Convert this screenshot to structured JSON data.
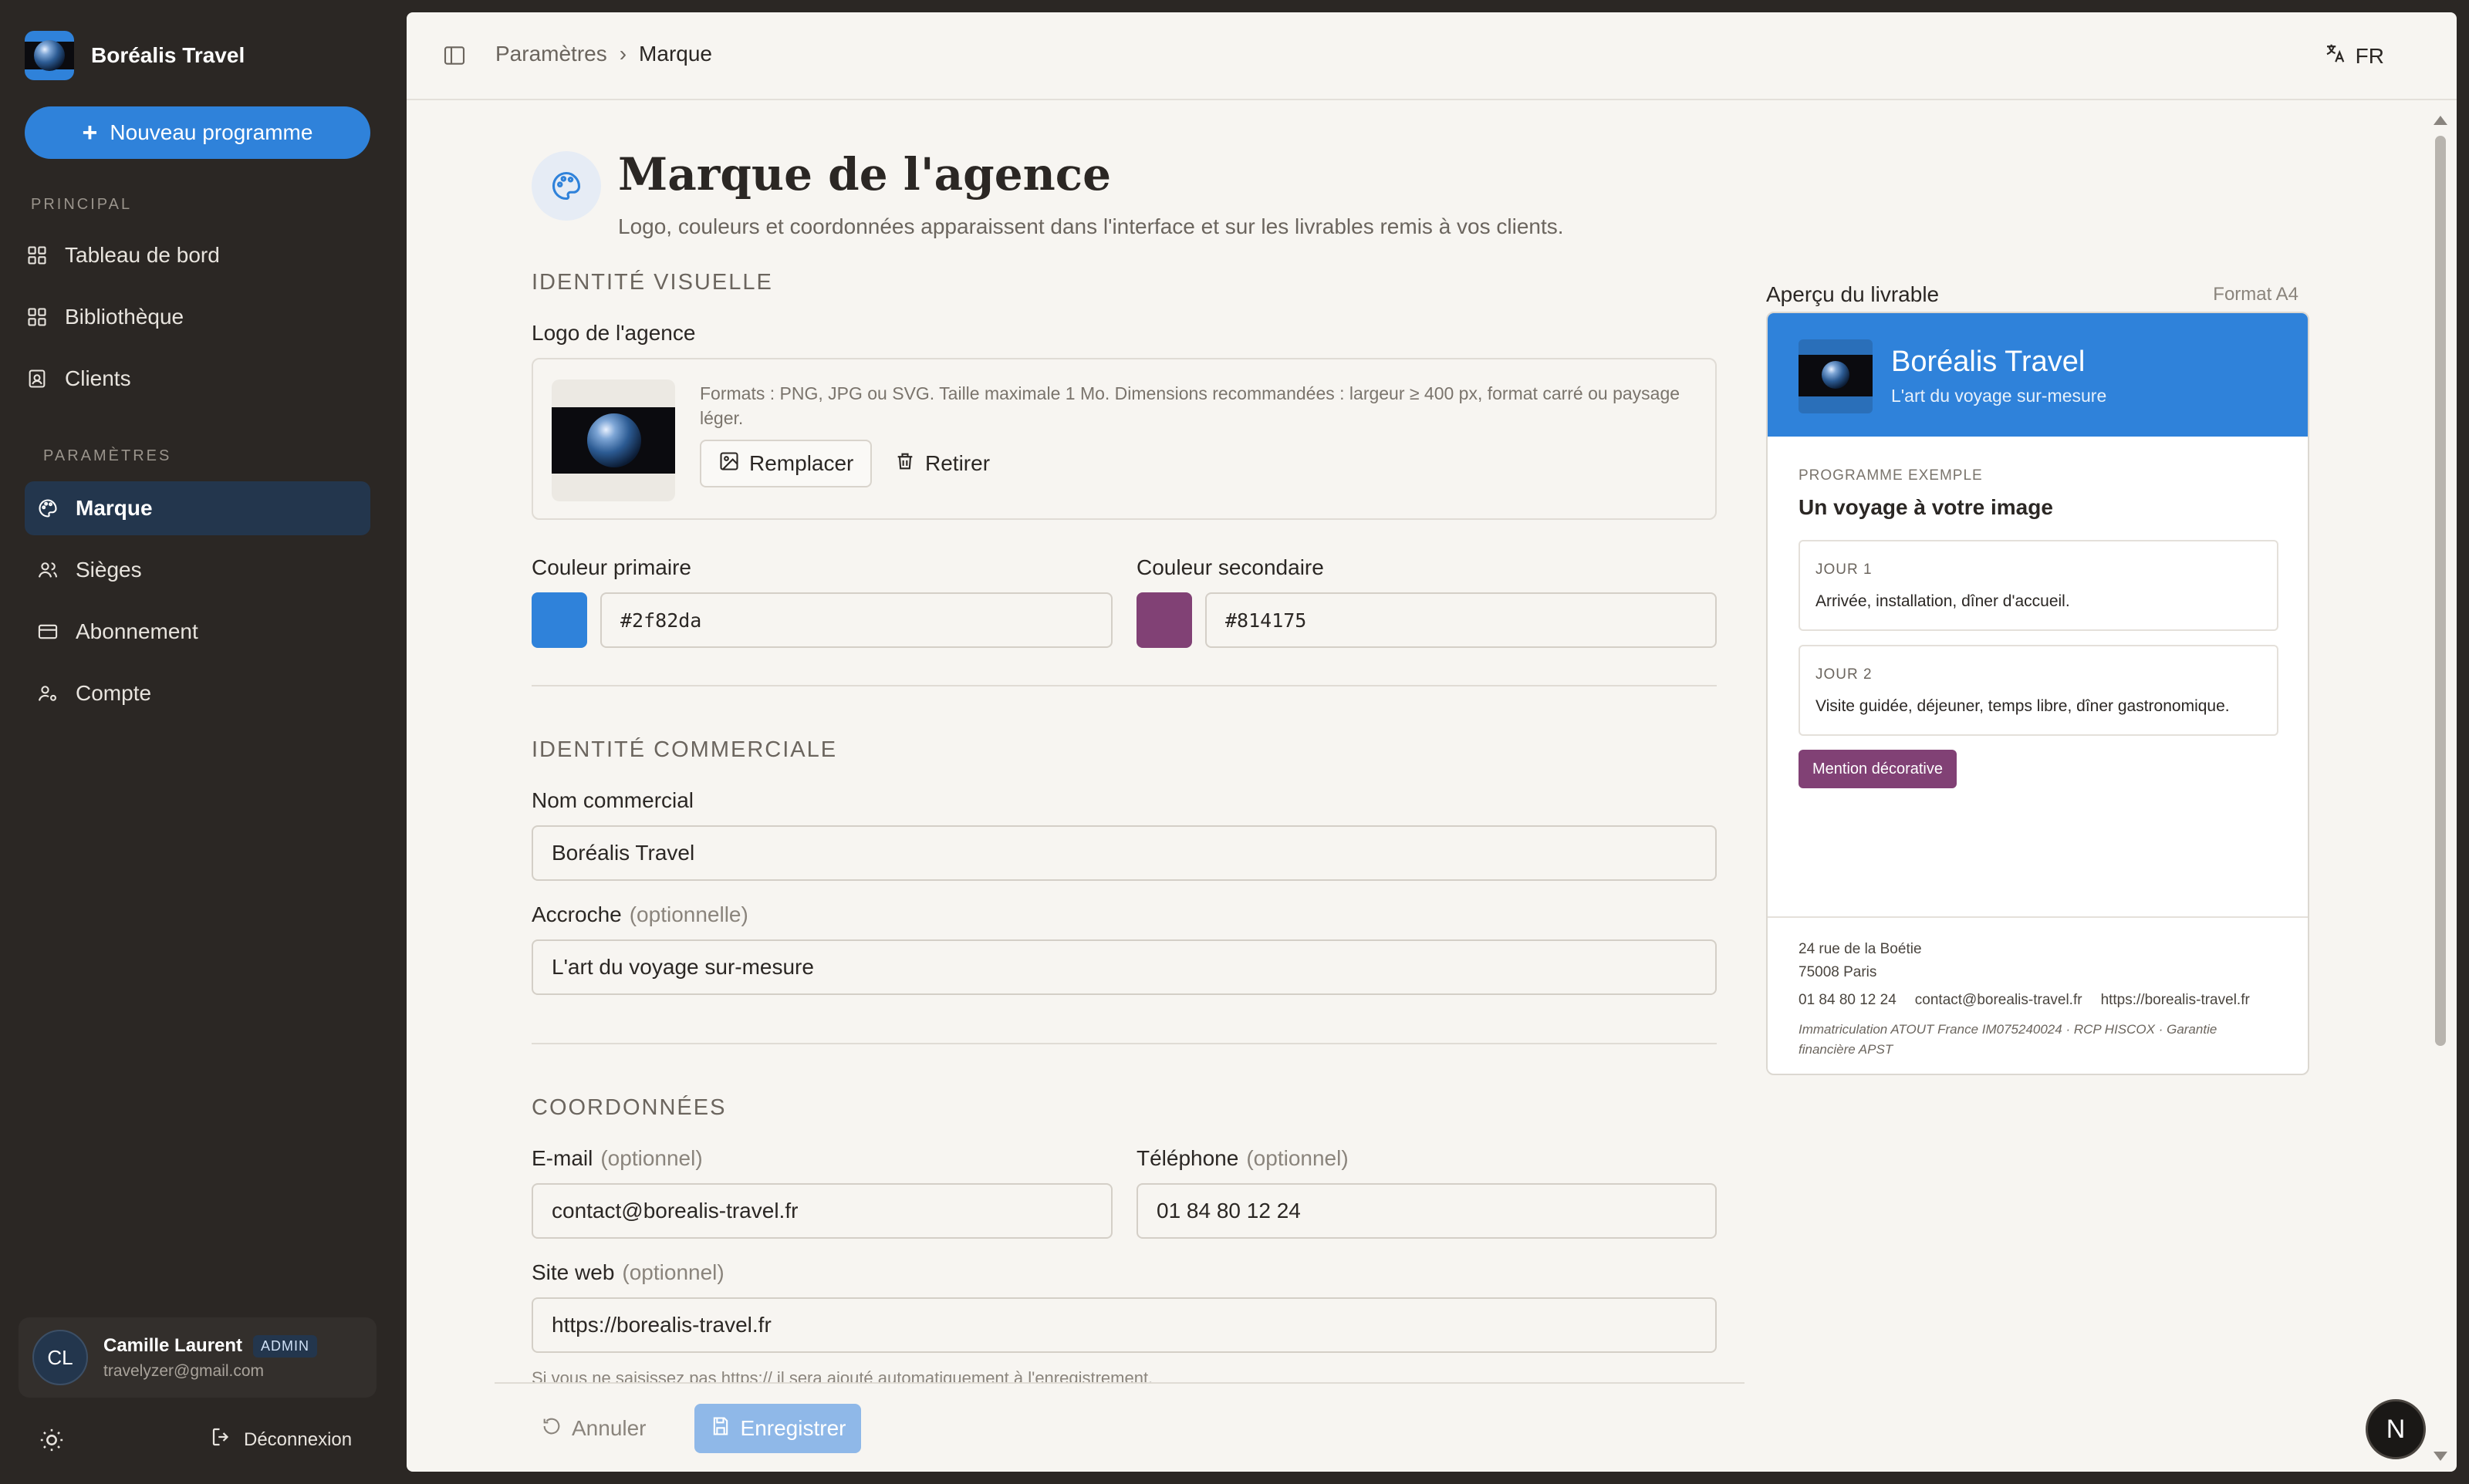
{
  "colors": {
    "accent": "#2f82da",
    "secondary": "#814175",
    "sidebar_bg": "#2b2724",
    "panel_bg": "#f7f5f1"
  },
  "sidebar": {
    "brand": "Boréalis Travel",
    "new_button": "Nouveau programme",
    "section_main": "PRINCIPAL",
    "main_items": [
      {
        "label": "Tableau de bord",
        "icon": "grid-icon"
      },
      {
        "label": "Bibliothèque",
        "icon": "grid-icon"
      },
      {
        "label": "Clients",
        "icon": "contact-card-icon"
      }
    ],
    "section_settings": "PARAMÈTRES",
    "settings_items": [
      {
        "label": "Marque",
        "icon": "palette-icon",
        "active": true
      },
      {
        "label": "Sièges",
        "icon": "users-icon"
      },
      {
        "label": "Abonnement",
        "icon": "credit-card-icon"
      },
      {
        "label": "Compte",
        "icon": "user-settings-icon"
      }
    ],
    "user": {
      "initials": "CL",
      "name": "Camille Laurent",
      "role": "ADMIN",
      "email": "travelyzer@gmail.com"
    },
    "logout": "Déconnexion"
  },
  "topbar": {
    "breadcrumb_parent": "Paramètres",
    "breadcrumb_current": "Marque",
    "language": "FR"
  },
  "page": {
    "title": "Marque de l'agence",
    "subtitle": "Logo, couleurs et coordonnées apparaissent dans l'interface et sur les livrables remis à vos clients."
  },
  "visual_identity": {
    "heading": "IDENTITÉ VISUELLE",
    "logo_label": "Logo de l'agence",
    "logo_info": "Formats : PNG, JPG ou SVG. Taille maximale 1 Mo. Dimensions recommandées : largeur ≥ 400 px, format carré ou paysage léger.",
    "replace_button": "Remplacer",
    "remove_button": "Retirer",
    "primary_label": "Couleur primaire",
    "primary_value": "#2f82da",
    "secondary_label": "Couleur secondaire",
    "secondary_value": "#814175"
  },
  "commercial_identity": {
    "heading": "IDENTITÉ COMMERCIALE",
    "name_label": "Nom commercial",
    "name_value": "Boréalis Travel",
    "tagline_label": "Accroche",
    "tagline_optional": "(optionnelle)",
    "tagline_value": "L'art du voyage sur-mesure"
  },
  "contact": {
    "heading": "COORDONNÉES",
    "email_label": "E-mail",
    "email_optional": "(optionnel)",
    "email_value": "contact@borealis-travel.fr",
    "phone_label": "Téléphone",
    "phone_optional": "(optionnel)",
    "phone_value": "01 84 80 12 24",
    "website_label": "Site web",
    "website_optional": "(optionnel)",
    "website_value": "https://borealis-travel.fr",
    "website_hint": "Si vous ne saisissez pas https:// il sera ajouté automatiquement à l'enregistrement."
  },
  "actions": {
    "cancel": "Annuler",
    "save": "Enregistrer"
  },
  "preview": {
    "title": "Aperçu du livrable",
    "format": "Format A4",
    "agency_name": "Boréalis Travel",
    "tagline": "L'art du voyage sur-mesure",
    "kicker": "PROGRAMME EXEMPLE",
    "program_title": "Un voyage à votre image",
    "days": [
      {
        "label": "JOUR 1",
        "text": "Arrivée, installation, dîner d'accueil."
      },
      {
        "label": "JOUR 2",
        "text": "Visite guidée, déjeuner, temps libre, dîner gastronomique."
      }
    ],
    "badge": "Mention décorative",
    "address_line1": "24 rue de la Boétie",
    "address_line2": "75008 Paris",
    "phone": "01 84 80 12 24",
    "email": "contact@borealis-travel.fr",
    "website": "https://borealis-travel.fr",
    "legal": "Immatriculation ATOUT France IM075240024 · RCP HISCOX · Garantie financière APST"
  },
  "fab": "N"
}
